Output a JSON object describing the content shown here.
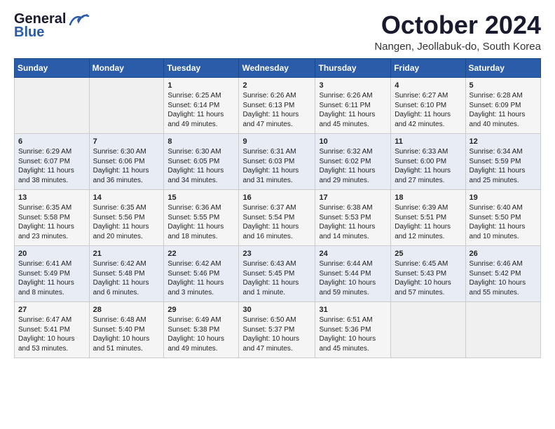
{
  "header": {
    "logo_line1": "General",
    "logo_line2": "Blue",
    "month": "October 2024",
    "location": "Nangen, Jeollabuk-do, South Korea"
  },
  "weekdays": [
    "Sunday",
    "Monday",
    "Tuesday",
    "Wednesday",
    "Thursday",
    "Friday",
    "Saturday"
  ],
  "weeks": [
    [
      {
        "day": "",
        "sunrise": "",
        "sunset": "",
        "daylight": ""
      },
      {
        "day": "",
        "sunrise": "",
        "sunset": "",
        "daylight": ""
      },
      {
        "day": "1",
        "sunrise": "Sunrise: 6:25 AM",
        "sunset": "Sunset: 6:14 PM",
        "daylight": "Daylight: 11 hours and 49 minutes."
      },
      {
        "day": "2",
        "sunrise": "Sunrise: 6:26 AM",
        "sunset": "Sunset: 6:13 PM",
        "daylight": "Daylight: 11 hours and 47 minutes."
      },
      {
        "day": "3",
        "sunrise": "Sunrise: 6:26 AM",
        "sunset": "Sunset: 6:11 PM",
        "daylight": "Daylight: 11 hours and 45 minutes."
      },
      {
        "day": "4",
        "sunrise": "Sunrise: 6:27 AM",
        "sunset": "Sunset: 6:10 PM",
        "daylight": "Daylight: 11 hours and 42 minutes."
      },
      {
        "day": "5",
        "sunrise": "Sunrise: 6:28 AM",
        "sunset": "Sunset: 6:09 PM",
        "daylight": "Daylight: 11 hours and 40 minutes."
      }
    ],
    [
      {
        "day": "6",
        "sunrise": "Sunrise: 6:29 AM",
        "sunset": "Sunset: 6:07 PM",
        "daylight": "Daylight: 11 hours and 38 minutes."
      },
      {
        "day": "7",
        "sunrise": "Sunrise: 6:30 AM",
        "sunset": "Sunset: 6:06 PM",
        "daylight": "Daylight: 11 hours and 36 minutes."
      },
      {
        "day": "8",
        "sunrise": "Sunrise: 6:30 AM",
        "sunset": "Sunset: 6:05 PM",
        "daylight": "Daylight: 11 hours and 34 minutes."
      },
      {
        "day": "9",
        "sunrise": "Sunrise: 6:31 AM",
        "sunset": "Sunset: 6:03 PM",
        "daylight": "Daylight: 11 hours and 31 minutes."
      },
      {
        "day": "10",
        "sunrise": "Sunrise: 6:32 AM",
        "sunset": "Sunset: 6:02 PM",
        "daylight": "Daylight: 11 hours and 29 minutes."
      },
      {
        "day": "11",
        "sunrise": "Sunrise: 6:33 AM",
        "sunset": "Sunset: 6:00 PM",
        "daylight": "Daylight: 11 hours and 27 minutes."
      },
      {
        "day": "12",
        "sunrise": "Sunrise: 6:34 AM",
        "sunset": "Sunset: 5:59 PM",
        "daylight": "Daylight: 11 hours and 25 minutes."
      }
    ],
    [
      {
        "day": "13",
        "sunrise": "Sunrise: 6:35 AM",
        "sunset": "Sunset: 5:58 PM",
        "daylight": "Daylight: 11 hours and 23 minutes."
      },
      {
        "day": "14",
        "sunrise": "Sunrise: 6:35 AM",
        "sunset": "Sunset: 5:56 PM",
        "daylight": "Daylight: 11 hours and 20 minutes."
      },
      {
        "day": "15",
        "sunrise": "Sunrise: 6:36 AM",
        "sunset": "Sunset: 5:55 PM",
        "daylight": "Daylight: 11 hours and 18 minutes."
      },
      {
        "day": "16",
        "sunrise": "Sunrise: 6:37 AM",
        "sunset": "Sunset: 5:54 PM",
        "daylight": "Daylight: 11 hours and 16 minutes."
      },
      {
        "day": "17",
        "sunrise": "Sunrise: 6:38 AM",
        "sunset": "Sunset: 5:53 PM",
        "daylight": "Daylight: 11 hours and 14 minutes."
      },
      {
        "day": "18",
        "sunrise": "Sunrise: 6:39 AM",
        "sunset": "Sunset: 5:51 PM",
        "daylight": "Daylight: 11 hours and 12 minutes."
      },
      {
        "day": "19",
        "sunrise": "Sunrise: 6:40 AM",
        "sunset": "Sunset: 5:50 PM",
        "daylight": "Daylight: 11 hours and 10 minutes."
      }
    ],
    [
      {
        "day": "20",
        "sunrise": "Sunrise: 6:41 AM",
        "sunset": "Sunset: 5:49 PM",
        "daylight": "Daylight: 11 hours and 8 minutes."
      },
      {
        "day": "21",
        "sunrise": "Sunrise: 6:42 AM",
        "sunset": "Sunset: 5:48 PM",
        "daylight": "Daylight: 11 hours and 6 minutes."
      },
      {
        "day": "22",
        "sunrise": "Sunrise: 6:42 AM",
        "sunset": "Sunset: 5:46 PM",
        "daylight": "Daylight: 11 hours and 3 minutes."
      },
      {
        "day": "23",
        "sunrise": "Sunrise: 6:43 AM",
        "sunset": "Sunset: 5:45 PM",
        "daylight": "Daylight: 11 hours and 1 minute."
      },
      {
        "day": "24",
        "sunrise": "Sunrise: 6:44 AM",
        "sunset": "Sunset: 5:44 PM",
        "daylight": "Daylight: 10 hours and 59 minutes."
      },
      {
        "day": "25",
        "sunrise": "Sunrise: 6:45 AM",
        "sunset": "Sunset: 5:43 PM",
        "daylight": "Daylight: 10 hours and 57 minutes."
      },
      {
        "day": "26",
        "sunrise": "Sunrise: 6:46 AM",
        "sunset": "Sunset: 5:42 PM",
        "daylight": "Daylight: 10 hours and 55 minutes."
      }
    ],
    [
      {
        "day": "27",
        "sunrise": "Sunrise: 6:47 AM",
        "sunset": "Sunset: 5:41 PM",
        "daylight": "Daylight: 10 hours and 53 minutes."
      },
      {
        "day": "28",
        "sunrise": "Sunrise: 6:48 AM",
        "sunset": "Sunset: 5:40 PM",
        "daylight": "Daylight: 10 hours and 51 minutes."
      },
      {
        "day": "29",
        "sunrise": "Sunrise: 6:49 AM",
        "sunset": "Sunset: 5:38 PM",
        "daylight": "Daylight: 10 hours and 49 minutes."
      },
      {
        "day": "30",
        "sunrise": "Sunrise: 6:50 AM",
        "sunset": "Sunset: 5:37 PM",
        "daylight": "Daylight: 10 hours and 47 minutes."
      },
      {
        "day": "31",
        "sunrise": "Sunrise: 6:51 AM",
        "sunset": "Sunset: 5:36 PM",
        "daylight": "Daylight: 10 hours and 45 minutes."
      },
      {
        "day": "",
        "sunrise": "",
        "sunset": "",
        "daylight": ""
      },
      {
        "day": "",
        "sunrise": "",
        "sunset": "",
        "daylight": ""
      }
    ]
  ]
}
